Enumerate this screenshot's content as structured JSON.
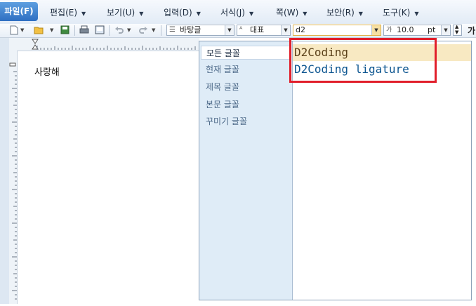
{
  "menubar": {
    "file": "파일(F)",
    "items": [
      {
        "label": "편집(E)"
      },
      {
        "label": "보기(U)"
      },
      {
        "label": "입력(D)"
      },
      {
        "label": "서식(J)"
      },
      {
        "label": "쪽(W)"
      },
      {
        "label": "보안(R)"
      },
      {
        "label": "도구(K)"
      }
    ]
  },
  "toolbar": {
    "style_combo": "바탕글",
    "lang_combo": "대표",
    "font_input": "d2",
    "size_value": "10.0",
    "size_unit": "pt",
    "size_icon_text": "가",
    "trailing": "가"
  },
  "icons": {
    "new": "new-document-icon",
    "open": "open-folder-icon",
    "save": "save-icon",
    "print": "print-icon",
    "preview": "print-preview-icon",
    "undo": "undo-icon",
    "redo": "redo-icon",
    "style": "paragraph-style-icon",
    "language": "language-icon"
  },
  "document": {
    "text": "사랑해"
  },
  "font_dropdown": {
    "categories": [
      {
        "label": "모든 글꼴"
      },
      {
        "label": "현재 글꼴"
      },
      {
        "label": "제목 글꼴"
      },
      {
        "label": "본문 글꼴"
      },
      {
        "label": "꾸미기 글꼴"
      }
    ],
    "fonts": [
      {
        "label": "D2Coding"
      },
      {
        "label": "D2Coding ligature"
      }
    ]
  },
  "colors": {
    "file_menu": "#3a7fd0",
    "highlight_border": "#e11f2b",
    "selected_font_bg": "#f8e9c2",
    "category_bg": "#dfecf7"
  }
}
